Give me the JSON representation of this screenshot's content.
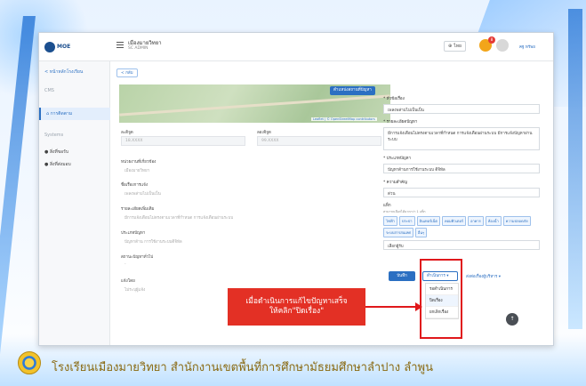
{
  "slide": {
    "footer_text": "โรงเรียนเมืองมายวิทยา  สำนักงานเขตพื้นที่การศึกษามัธยมศึกษาลำปาง  ลำพูน"
  },
  "header": {
    "logo_text": "MOE",
    "school_name": "เมืองมายวิทยา",
    "role": "SC ADMIN",
    "lang_label": "ไทย",
    "notification_count": "8",
    "user_name": "คฐ ทรัพย"
  },
  "sidebar": {
    "back_label": "หน้าหลักโรงเรียน",
    "items": [
      {
        "label": "CMS"
      },
      {
        "label": "การติดตาม"
      },
      {
        "label": "Systems"
      },
      {
        "label": "สิ่งที่ขอรับ"
      },
      {
        "label": "สิ่งที่ส่งมอบ"
      }
    ]
  },
  "content": {
    "back_tag": "< กลับ",
    "map_button": "ตำแหน่งสถานที่ปัญหา",
    "map_credit": "Leaflet | © OpenStreetMap contributors",
    "lat_label": "ละติจูด",
    "lat_value": "18.XXXX",
    "lng_label": "ลองจิจูด",
    "lng_value": "99.XXXX",
    "unit_label": "หน่วยงานที่เกี่ยวข้อง",
    "unit_value": "เมืองมายวิทยา",
    "subject_label": "ชื่อเรื่องการแจ้ง",
    "subject_value": "เพลงพล่ามไม่เป็นเป็น",
    "detail_label": "รายละเอียดเพิ่มเติม",
    "detail_value": "มีการแจ้งเตือนไม่ตรงตามเวลาที่กำหนด การแจ้งเตือนผ่านระบบ",
    "type_label": "ประเภทปัญหา",
    "type_value": "ปัญหาด้าน การใช้งานระบบดิจิทัล",
    "status_label": "สถานะปัญหาทั่วไป",
    "status_value": "-",
    "reporter_label": "แจ้งโดย",
    "reporter_value": "ไม่ระบุผู้แจ้ง"
  },
  "right_panel": {
    "subject_label": "* หัวข้อเรื่อง",
    "subject_value": "เพลงพล่ามไม่เป็นเป็น",
    "detail_label": "* รายละเอียดปัญหา",
    "detail_value": "มีการแจ้งเตือนไม่ตรงตามเวลาที่กำหนด การแจ้งเตือนผ่านระบบ มีการแจ้งปัญหาผ่านระบบ",
    "category_label": "* ประเภทปัญหา",
    "category_value": "ปัญหาด้านการใช้งานระบบ ดิจิทัล",
    "priority_label": "* ความสำคัญ",
    "priority_value": "ด่วน",
    "tags_label": "แท็ก",
    "hint": "สามารถเลือกได้มากกว่า 1 แท็ก",
    "tags": [
      "ไฟฟ้า",
      "ประปา",
      "อินเทอร์เน็ต",
      "คอมพิวเตอร์",
      "อาคาร",
      "ห้องน้ำ",
      "ความปลอดภัย",
      "ระบบสารสนเทศ",
      "อื่นๆ"
    ],
    "assignee_value": "เลือกผู้รับ",
    "save_label": "บันทึก",
    "action_label": "ดำเนินการ",
    "report_label": "ส่งต่อเรื่องผู้บริหาร",
    "menu_items": [
      "รอดำเนินการ",
      "ปิดเรื่อง",
      "ยกเลิกเรื่อง"
    ]
  },
  "annotation": {
    "callout_line1": "เมื่อดำเนินการแก้ไขปัญหาเสร็จ",
    "callout_line2": "ให้คลิก\"ปิดเรื่อง\""
  },
  "colors": {
    "accent": "#2b6fc2",
    "callout": "#e33025",
    "frame": "#e0181b"
  }
}
